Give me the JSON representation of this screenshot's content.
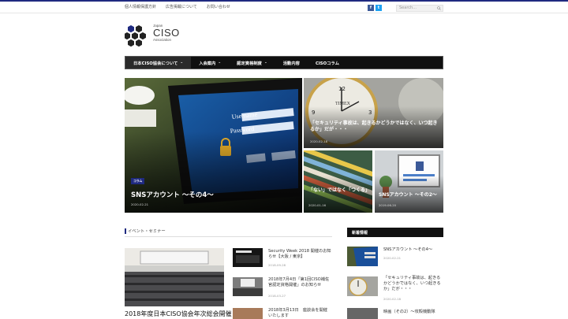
{
  "topbar": {
    "links": [
      "個人情報保護方針",
      "広告掲載について",
      "お問い合わせ"
    ],
    "search_placeholder": "Search...",
    "social": {
      "fb": "f",
      "tw": "t"
    }
  },
  "logo": {
    "line1": "Japan",
    "line2": "CISO",
    "line3": "Association"
  },
  "nav": {
    "items": [
      {
        "label": "日本CISO協会について",
        "chevron": "⌄"
      },
      {
        "label": "入会案内",
        "chevron": "⌄"
      },
      {
        "label": "認定資格制度",
        "chevron": "⌄"
      },
      {
        "label": "活動内容",
        "chevron": ""
      },
      {
        "label": "CISOコラム",
        "chevron": ""
      }
    ]
  },
  "featured": {
    "main": {
      "badge": "コラム",
      "title": "SNSアカウント 〜その4〜",
      "date": "2020-02-21"
    },
    "top_right": {
      "title": "「セキュリティ事故は、起きるかどうかではなく、いつ起きるか」だが・・・",
      "date": "2020-02-18"
    },
    "bottom_left": {
      "title": "「ない」ではなく「つくる」",
      "date": "2020-01-16"
    },
    "bottom_right": {
      "title": "SNSアカウント 〜その2〜",
      "date": "2019-06-20"
    }
  },
  "events": {
    "heading": "イベント・セミナー",
    "main_title": "2018年度日本CISO協会年次総会開催",
    "items": [
      {
        "title": "Security Week 2018 開催のお知らせ【大阪 / 東京】",
        "date": "2018-09-28"
      },
      {
        "title": "2018年7月4日「第1回CISO補佐官認定資格開催」のお知らせ",
        "date": "2018-03-27"
      },
      {
        "title": "2018年3月13日　座談会を開催いたします",
        "date": ""
      }
    ]
  },
  "sidebar": {
    "heading": "新着情報",
    "items": [
      {
        "title": "SNSアカウント 〜その4〜",
        "date": "2020-02-21"
      },
      {
        "title": "「セキュリティ事故は、起きるかどうかではなく、いつ起きるか」だが・・・",
        "date": "2020-02-18"
      },
      {
        "title": "映画（その2）〜攻殻機動隊",
        "date": ""
      }
    ]
  }
}
